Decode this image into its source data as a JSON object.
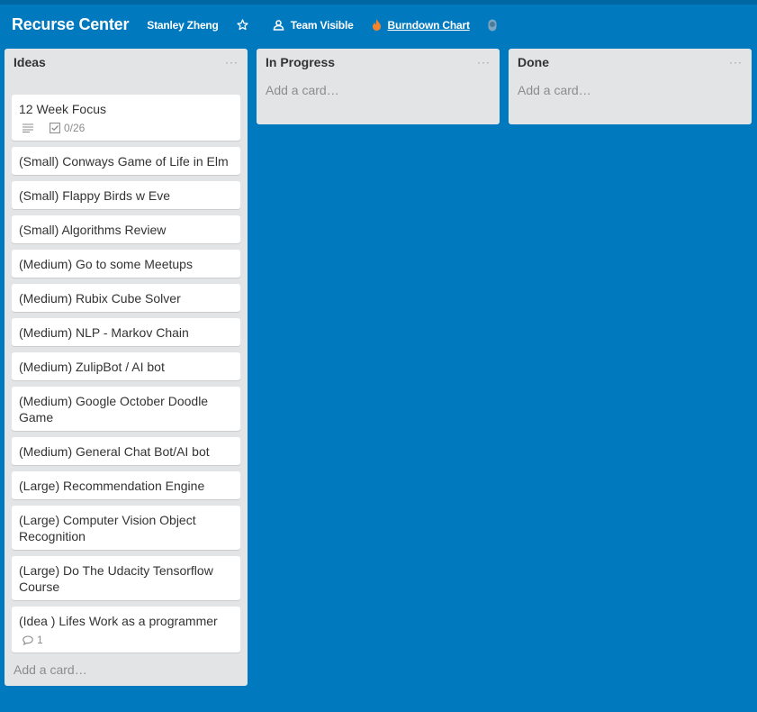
{
  "header": {
    "board_title": "Recurse Center",
    "owner": "Stanley Zheng",
    "visibility": "Team Visible",
    "powerup": "Burndown Chart",
    "icons": {
      "star": "star-icon",
      "team": "team-icon",
      "flame": "flame-icon",
      "user": "user-icon"
    }
  },
  "lists": [
    {
      "title": "Ideas",
      "menu": "···",
      "add_card": "Add a card…",
      "cards": [
        {
          "title": "12 Week Focus",
          "has_description": true,
          "checklist": "0/26"
        },
        {
          "title": "(Small) Conways Game of Life in Elm"
        },
        {
          "title": "(Small) Flappy Birds w Eve"
        },
        {
          "title": "(Small) Algorithms Review"
        },
        {
          "title": "(Medium) Go to some Meetups"
        },
        {
          "title": "(Medium) Rubix Cube Solver"
        },
        {
          "title": "(Medium) NLP - Markov Chain"
        },
        {
          "title": "(Medium) ZulipBot / AI bot"
        },
        {
          "title": "(Medium) Google October Doodle Game"
        },
        {
          "title": "(Medium) General Chat Bot/AI bot"
        },
        {
          "title": "(Large) Recommendation Engine"
        },
        {
          "title": "(Large) Computer Vision Object Recognition"
        },
        {
          "title": "(Large) Do The Udacity Tensorflow Course"
        },
        {
          "title": "(Idea ) Lifes Work as a programmer",
          "comments": "1"
        }
      ]
    },
    {
      "title": "In Progress",
      "menu": "···",
      "add_card": "Add a card…",
      "cards": []
    },
    {
      "title": "Done",
      "menu": "···",
      "add_card": "Add a card…",
      "cards": []
    }
  ],
  "colors": {
    "board_bg": "#0079bf",
    "list_bg": "#e2e4e6",
    "card_bg": "#ffffff"
  }
}
